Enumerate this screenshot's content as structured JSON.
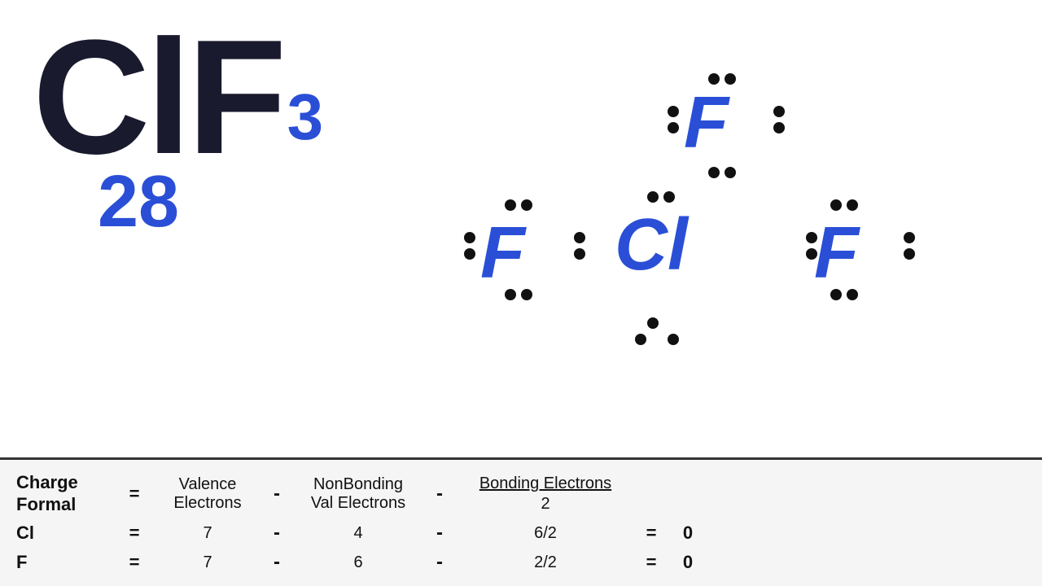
{
  "molecule": {
    "formula": "ClF",
    "subscript": "3",
    "total_electrons": "28"
  },
  "lewis": {
    "atoms": [
      {
        "label": "F",
        "top": "top"
      },
      {
        "label": "F",
        "position": "left"
      },
      {
        "label": "Cl",
        "position": "center"
      },
      {
        "label": "F",
        "position": "right"
      }
    ]
  },
  "formula_section": {
    "charge_formal_label": "Charge\nFormal",
    "equals": "=",
    "valence_header": "Valence\nElectrons",
    "minus1": "-",
    "nonbonding_header": "NonBonding\nVal Electrons",
    "minus2": "-",
    "bonding_header": "Bonding Electrons",
    "bonding_denom": "2",
    "rows": [
      {
        "element": "Cl",
        "eq": "=",
        "valence": "7",
        "minus1": "-",
        "nonbonding": "4",
        "minus2": "-",
        "bonding_expr": "6/2",
        "eq2": "=",
        "result": "0"
      },
      {
        "element": "F",
        "eq": "=",
        "valence": "7",
        "minus1": "-",
        "nonbonding": "6",
        "minus2": "-",
        "bonding_expr": "2/2",
        "eq2": "=",
        "result": "0"
      }
    ]
  }
}
